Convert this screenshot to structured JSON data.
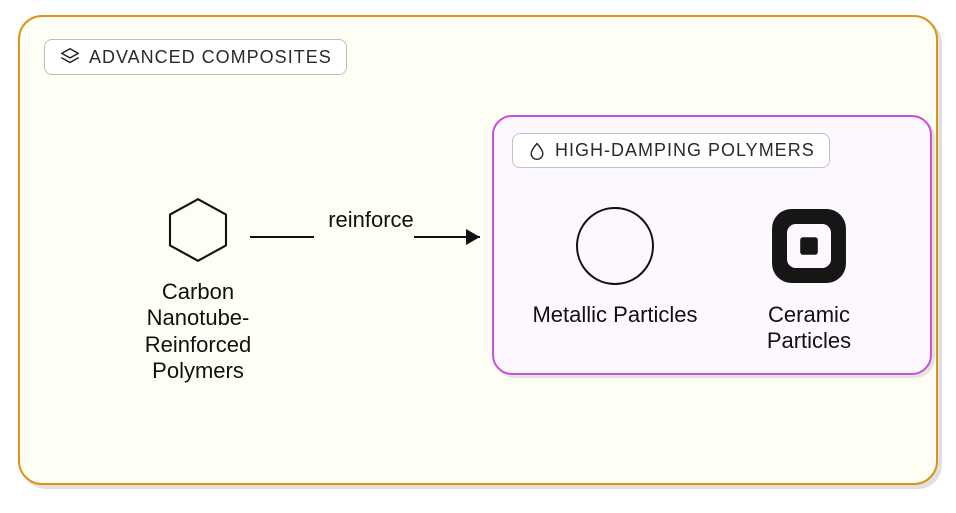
{
  "outer": {
    "title": "ADVANCED COMPOSITES"
  },
  "cnt": {
    "label": "Carbon Nanotube-Reinforced Polymers"
  },
  "edge": {
    "label": "reinforce"
  },
  "inner": {
    "title": "HIGH-DAMPING POLYMERS",
    "particles": [
      {
        "label": "Metallic Particles"
      },
      {
        "label": "Ceramic Particles"
      }
    ]
  }
}
